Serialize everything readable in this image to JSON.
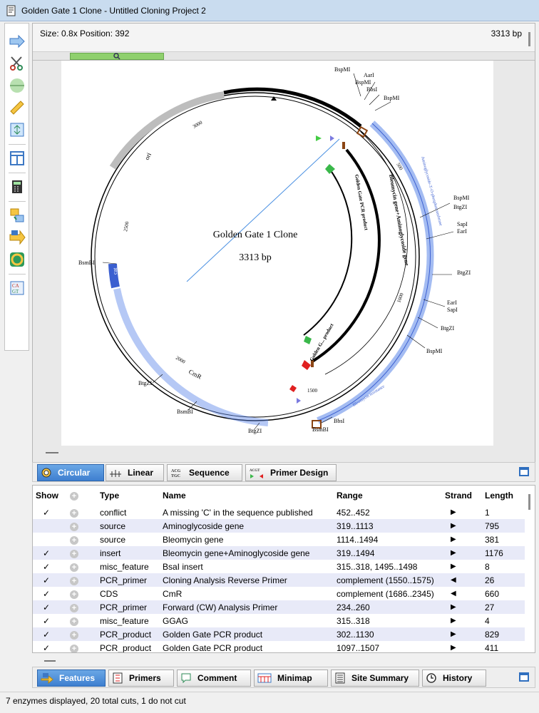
{
  "window": {
    "title": "Golden Gate 1 Clone - Untitled Cloning Project 2"
  },
  "infobar": {
    "size_label": "Size: 0.8x  Position: 392",
    "length": "3313 bp"
  },
  "map": {
    "name": "Golden Gate 1 Clone",
    "length": "3313 bp",
    "ticks": [
      "500",
      "1000",
      "1500",
      "2000",
      "2500",
      "3000"
    ],
    "feature_labels": [
      "ori",
      "cat",
      "CmR",
      "Bleomycin gene+Aminoglycoside gene",
      "Golden Gate PCR product",
      "Golden G... product",
      "Aminoglycoside-3'-O-phosphotransferase",
      "Bleomycin resistance"
    ],
    "enzymes": [
      "BspMI",
      "AarI",
      "BspMI",
      "BbsI",
      "BspMI",
      "BspMI",
      "BtgZI",
      "SapI",
      "EarI",
      "BtgZI",
      "EarI",
      "SapI",
      "BtgZI",
      "BspMI",
      "BbsI",
      "BsmBI",
      "BtgZI",
      "BsmBI",
      "BtgZI",
      "BsmBI"
    ]
  },
  "view_tabs": [
    "Circular",
    "Linear",
    "Sequence",
    "Primer Design"
  ],
  "features_table": {
    "columns": [
      "Show",
      "",
      "Type",
      "Name",
      "Range",
      "Strand",
      "Length"
    ],
    "rows": [
      {
        "show": "✓",
        "type": "conflict",
        "name": "A missing 'C' in the sequence published",
        "range": "452..452",
        "strand": "▶",
        "length": "1"
      },
      {
        "show": "",
        "type": "source",
        "name": "Aminoglycoside gene",
        "range": "319..1113",
        "strand": "▶",
        "length": "795"
      },
      {
        "show": "",
        "type": "source",
        "name": "Bleomycin gene",
        "range": "1114..1494",
        "strand": "▶",
        "length": "381"
      },
      {
        "show": "✓",
        "type": "insert",
        "name": "Bleomycin gene+Aminoglycoside gene",
        "range": "319..1494",
        "strand": "▶",
        "length": "1176"
      },
      {
        "show": "✓",
        "type": "misc_feature",
        "name": "BsaI insert",
        "range": "315..318, 1495..1498",
        "strand": "▶",
        "length": "8"
      },
      {
        "show": "✓",
        "type": "PCR_primer",
        "name": "Cloning Analysis Reverse Primer",
        "range": "complement (1550..1575)",
        "strand": "◀",
        "length": "26"
      },
      {
        "show": "✓",
        "type": "CDS",
        "name": "CmR",
        "range": "complement (1686..2345)",
        "strand": "◀",
        "length": "660"
      },
      {
        "show": "✓",
        "type": "PCR_primer",
        "name": "Forward (CW) Analysis Primer",
        "range": "234..260",
        "strand": "▶",
        "length": "27"
      },
      {
        "show": "✓",
        "type": "misc_feature",
        "name": "GGAG",
        "range": "315..318",
        "strand": "▶",
        "length": "4"
      },
      {
        "show": "✓",
        "type": "PCR_product",
        "name": "Golden Gate PCR product",
        "range": "302..1130",
        "strand": "▶",
        "length": "829"
      },
      {
        "show": "✓",
        "type": "PCR_product",
        "name": "Golden Gate PCR product",
        "range": "1097..1507",
        "strand": "▶",
        "length": "411"
      }
    ]
  },
  "bottom_tabs": [
    "Features",
    "Primers",
    "Comment",
    "Minimap",
    "Site Summary",
    "History"
  ],
  "status": "7 enzymes displayed, 20 total cuts, 1 do not cut"
}
